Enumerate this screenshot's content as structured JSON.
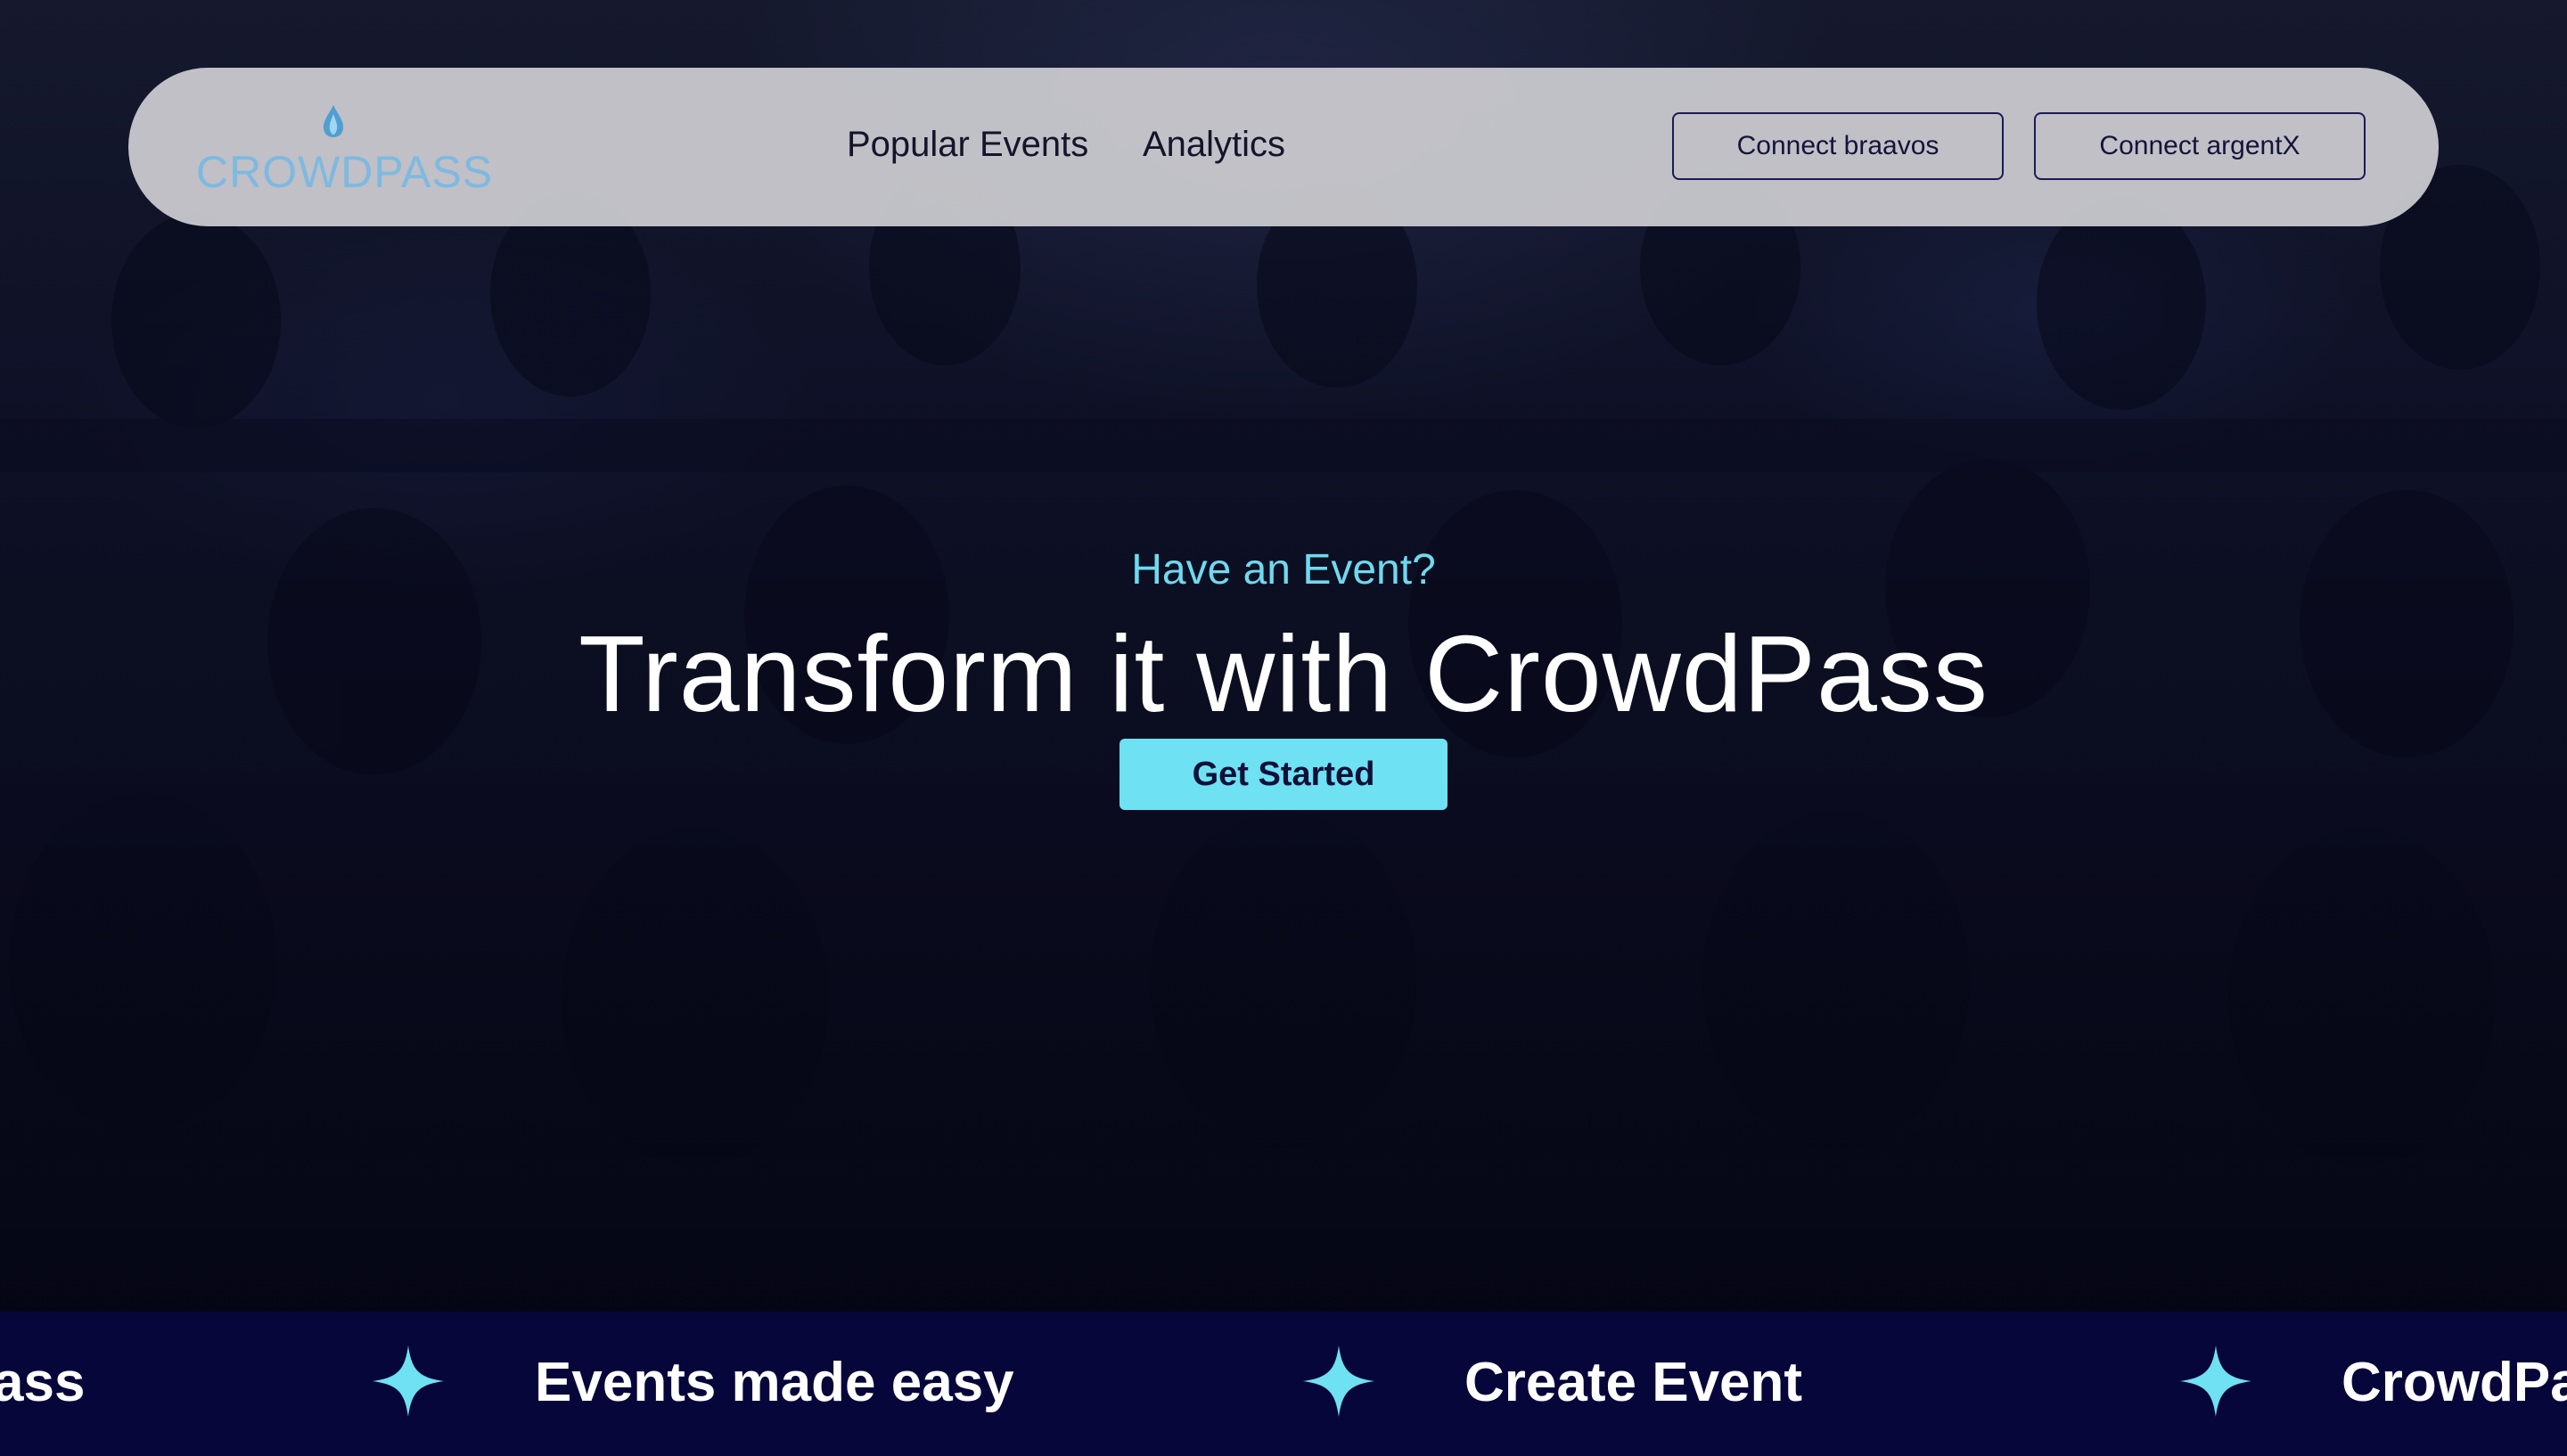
{
  "brand": {
    "logo_text": "CROWDPASS"
  },
  "nav": {
    "links": [
      "Popular Events",
      "Analytics"
    ],
    "wallet_buttons": [
      "Connect braavos",
      "Connect argentX"
    ]
  },
  "hero": {
    "eyebrow": "Have an Event?",
    "title": "Transform it with CrowdPass",
    "cta_label": "Get Started"
  },
  "marquee": {
    "items": [
      "ass",
      "Events made easy",
      "Create Event",
      "CrowdPa"
    ],
    "star_icon": "four-point-star-icon",
    "star_color": "#6ee1f2"
  },
  "colors": {
    "accent": "#6ee1f2",
    "navbar_bg": "#cdcdd2",
    "marquee_bg": "#07063a",
    "button_border": "#1c1b55"
  }
}
